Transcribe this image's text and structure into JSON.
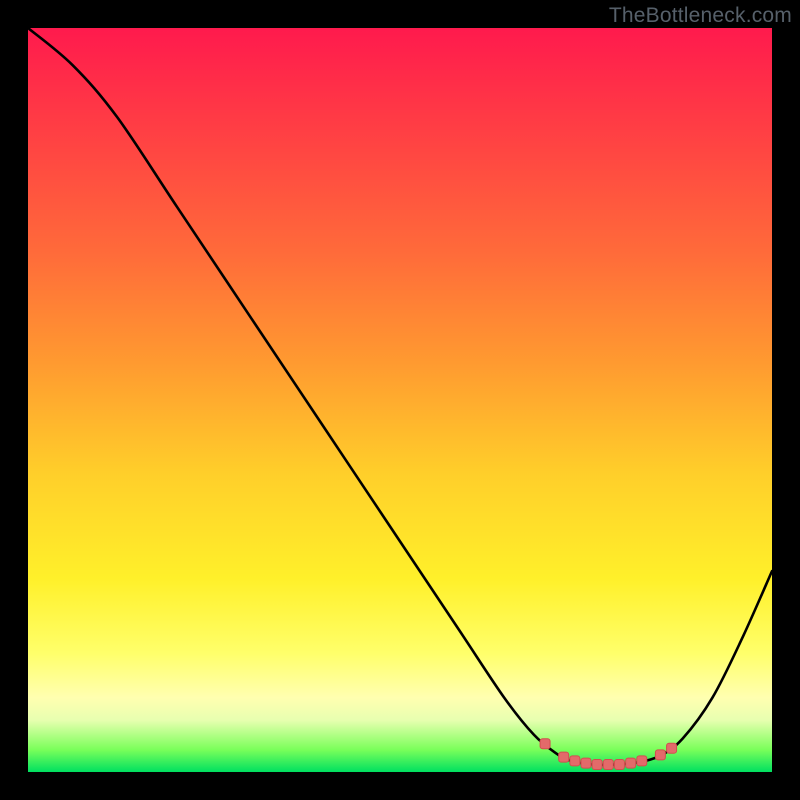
{
  "watermark": "TheBottleneck.com",
  "colors": {
    "curve_stroke": "#000000",
    "marker_fill": "#e36a6a",
    "marker_stroke": "#d24f4f",
    "gradient_top": "#ff1a4d",
    "gradient_bottom": "#00e060",
    "frame": "#000000"
  },
  "chart_data": {
    "type": "line",
    "title": "",
    "xlabel": "",
    "ylabel": "",
    "xlim": [
      0,
      100
    ],
    "ylim": [
      0,
      100
    ],
    "grid": false,
    "legend": false,
    "curve": [
      {
        "x": 0,
        "y": 100
      },
      {
        "x": 6,
        "y": 95
      },
      {
        "x": 12,
        "y": 88
      },
      {
        "x": 20,
        "y": 76
      },
      {
        "x": 30,
        "y": 61
      },
      {
        "x": 40,
        "y": 46
      },
      {
        "x": 50,
        "y": 31
      },
      {
        "x": 58,
        "y": 19
      },
      {
        "x": 64,
        "y": 10
      },
      {
        "x": 68,
        "y": 5
      },
      {
        "x": 71,
        "y": 2.5
      },
      {
        "x": 73,
        "y": 1.5
      },
      {
        "x": 76,
        "y": 1.0
      },
      {
        "x": 79,
        "y": 1.0
      },
      {
        "x": 82,
        "y": 1.3
      },
      {
        "x": 85,
        "y": 2.2
      },
      {
        "x": 88,
        "y": 4.5
      },
      {
        "x": 92,
        "y": 10
      },
      {
        "x": 96,
        "y": 18
      },
      {
        "x": 100,
        "y": 27
      }
    ],
    "markers": [
      {
        "x": 69.5,
        "y": 3.8
      },
      {
        "x": 72.0,
        "y": 2.0
      },
      {
        "x": 73.5,
        "y": 1.5
      },
      {
        "x": 75.0,
        "y": 1.2
      },
      {
        "x": 76.5,
        "y": 1.0
      },
      {
        "x": 78.0,
        "y": 1.0
      },
      {
        "x": 79.5,
        "y": 1.0
      },
      {
        "x": 81.0,
        "y": 1.2
      },
      {
        "x": 82.5,
        "y": 1.5
      },
      {
        "x": 85.0,
        "y": 2.3
      },
      {
        "x": 86.5,
        "y": 3.2
      }
    ]
  }
}
